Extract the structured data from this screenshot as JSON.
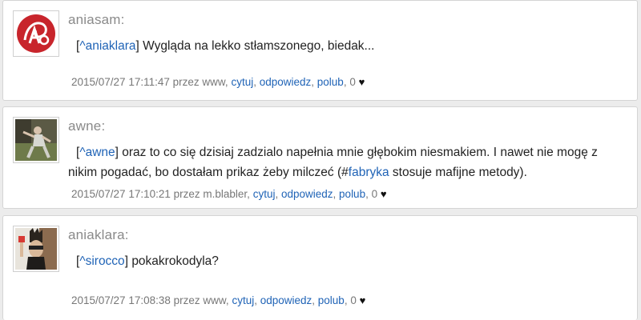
{
  "comments": [
    {
      "author": "aniasam:",
      "mention": "^aniaklara",
      "text": "Wygląda na lekko stłamszonego, biedak...",
      "timestamp": "2015/07/27 17:11:47",
      "via": "przez www,",
      "actions": {
        "quote": "cytuj",
        "reply": "odpowiedz",
        "like": "polub"
      },
      "likes": "0",
      "heart": "♥"
    },
    {
      "author": "awne:",
      "mention": "^awne",
      "text_before_tag": "oraz to co się dzisiaj zadzialo napełnia mnie głębokim niesmakiem. I nawet nie mogę z nikim pogadać, bo dostałam prikaz żeby milczeć (#",
      "tag": "fabryka",
      "text_after_tag": " stosuje mafijne metody).",
      "timestamp": "2015/07/27 17:10:21",
      "via": "przez m.blabler,",
      "actions": {
        "quote": "cytuj",
        "reply": "odpowiedz",
        "like": "polub"
      },
      "likes": "0",
      "heart": "♥"
    },
    {
      "author": "aniaklara:",
      "mention": "^sirocco",
      "text": "pokakrokodyla?",
      "timestamp": "2015/07/27 17:08:38",
      "via": "przez www,",
      "actions": {
        "quote": "cytuj",
        "reply": "odpowiedz",
        "like": "polub"
      },
      "likes": "0",
      "heart": "♥"
    }
  ],
  "colors": {
    "link": "#1f63b6",
    "author": "#8a8a8a",
    "meta": "#777777",
    "background": "#ececec"
  }
}
